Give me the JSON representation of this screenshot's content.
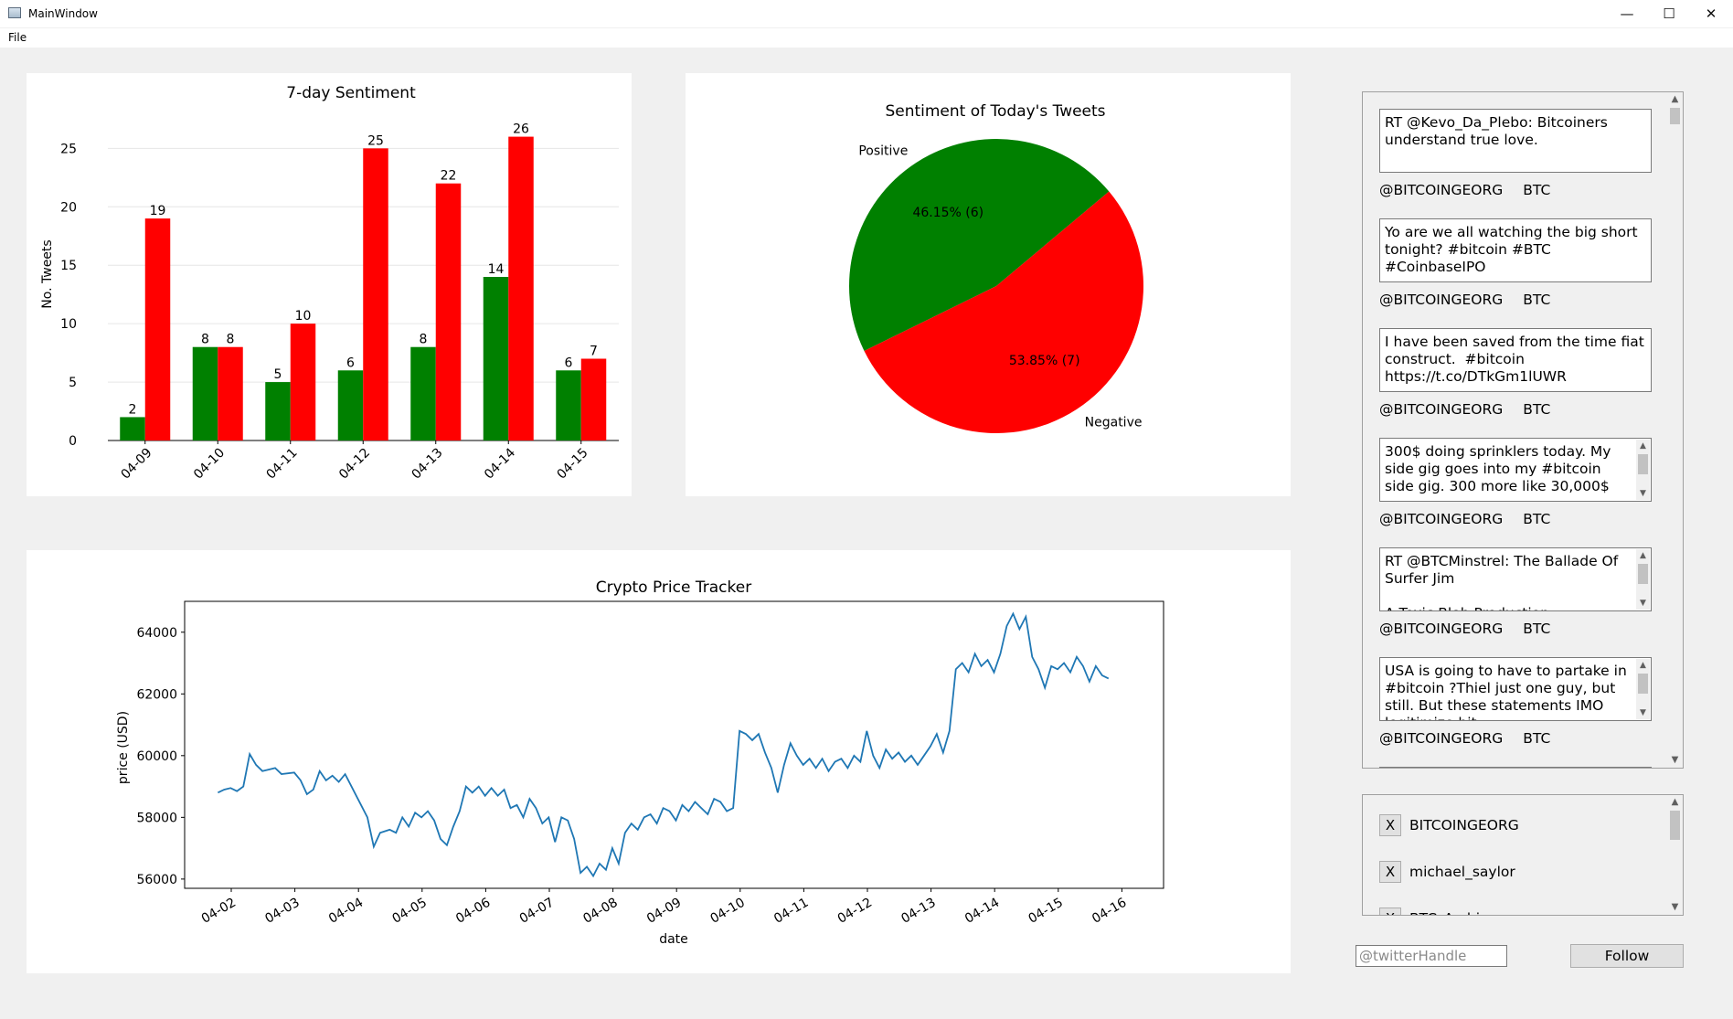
{
  "window": {
    "title": "MainWindow",
    "controls": {
      "minimize": "—",
      "maximize": "☐",
      "close": "✕"
    }
  },
  "menu": {
    "file": "File"
  },
  "sentiment7": {
    "chart_data": {
      "type": "bar",
      "title": "7-day Sentiment",
      "ylabel": "No. Tweets",
      "categories": [
        "04-09",
        "04-10",
        "04-11",
        "04-12",
        "04-13",
        "04-14",
        "04-15"
      ],
      "series": [
        {
          "values": [
            2,
            8,
            5,
            6,
            8,
            14,
            6
          ],
          "color": "#008000"
        },
        {
          "values": [
            19,
            8,
            10,
            25,
            22,
            26,
            7
          ],
          "color": "#ff0000"
        }
      ],
      "yticks": [
        0,
        5,
        10,
        15,
        20,
        25
      ],
      "ylim": [
        0,
        28
      ],
      "grid": true
    }
  },
  "today": {
    "chart_data": {
      "type": "pie",
      "title": "Sentiment of Today's Tweets",
      "slices": [
        {
          "label": "Positive",
          "value": 6,
          "pct_label": "46.15%  (6)",
          "color": "#008000"
        },
        {
          "label": "Negative",
          "value": 7,
          "pct_label": "53.85%  (7)",
          "color": "#ff0000"
        }
      ]
    }
  },
  "price": {
    "chart_data": {
      "type": "line",
      "title": "Crypto Price Tracker",
      "xlabel": "date",
      "ylabel": "price (USD)",
      "color": "#1f77b4",
      "yticks": [
        56000,
        58000,
        60000,
        62000,
        64000
      ],
      "ylim": [
        55700,
        65000
      ],
      "xticks": [
        "04-02",
        "04-03",
        "04-04",
        "04-05",
        "04-06",
        "04-07",
        "04-08",
        "04-09",
        "04-10",
        "04-11",
        "04-12",
        "04-13",
        "04-14",
        "04-15",
        "04-16"
      ],
      "x_start": "04-01 19:00",
      "x_end": "04-15 19:00",
      "points": [
        [
          0.0,
          58800
        ],
        [
          0.1,
          58900
        ],
        [
          0.2,
          58950
        ],
        [
          0.3,
          58850
        ],
        [
          0.4,
          59000
        ],
        [
          0.5,
          60050
        ],
        [
          0.6,
          59700
        ],
        [
          0.7,
          59500
        ],
        [
          0.9,
          59600
        ],
        [
          1.0,
          59400
        ],
        [
          1.2,
          59450
        ],
        [
          1.3,
          59200
        ],
        [
          1.4,
          58750
        ],
        [
          1.5,
          58900
        ],
        [
          1.6,
          59500
        ],
        [
          1.7,
          59200
        ],
        [
          1.8,
          59350
        ],
        [
          1.9,
          59150
        ],
        [
          2.0,
          59400
        ],
        [
          2.1,
          59000
        ],
        [
          2.2,
          58600
        ],
        [
          2.35,
          58000
        ],
        [
          2.45,
          57050
        ],
        [
          2.55,
          57500
        ],
        [
          2.7,
          57600
        ],
        [
          2.8,
          57500
        ],
        [
          2.9,
          58000
        ],
        [
          3.0,
          57700
        ],
        [
          3.1,
          58150
        ],
        [
          3.2,
          58000
        ],
        [
          3.3,
          58200
        ],
        [
          3.4,
          57900
        ],
        [
          3.5,
          57300
        ],
        [
          3.6,
          57100
        ],
        [
          3.7,
          57700
        ],
        [
          3.8,
          58200
        ],
        [
          3.9,
          59000
        ],
        [
          4.0,
          58800
        ],
        [
          4.1,
          59000
        ],
        [
          4.2,
          58700
        ],
        [
          4.3,
          58950
        ],
        [
          4.4,
          58700
        ],
        [
          4.5,
          58900
        ],
        [
          4.6,
          58300
        ],
        [
          4.7,
          58400
        ],
        [
          4.8,
          58000
        ],
        [
          4.9,
          58600
        ],
        [
          5.0,
          58300
        ],
        [
          5.1,
          57800
        ],
        [
          5.2,
          58000
        ],
        [
          5.3,
          57200
        ],
        [
          5.4,
          58000
        ],
        [
          5.5,
          57900
        ],
        [
          5.6,
          57300
        ],
        [
          5.7,
          56200
        ],
        [
          5.8,
          56400
        ],
        [
          5.9,
          56100
        ],
        [
          6.0,
          56500
        ],
        [
          6.1,
          56300
        ],
        [
          6.2,
          57000
        ],
        [
          6.3,
          56500
        ],
        [
          6.4,
          57500
        ],
        [
          6.5,
          57800
        ],
        [
          6.6,
          57600
        ],
        [
          6.7,
          58000
        ],
        [
          6.8,
          58100
        ],
        [
          6.9,
          57800
        ],
        [
          7.0,
          58300
        ],
        [
          7.1,
          58200
        ],
        [
          7.2,
          57900
        ],
        [
          7.3,
          58400
        ],
        [
          7.4,
          58200
        ],
        [
          7.5,
          58500
        ],
        [
          7.6,
          58300
        ],
        [
          7.7,
          58100
        ],
        [
          7.8,
          58600
        ],
        [
          7.9,
          58500
        ],
        [
          8.0,
          58200
        ],
        [
          8.1,
          58300
        ],
        [
          8.2,
          60800
        ],
        [
          8.3,
          60700
        ],
        [
          8.4,
          60500
        ],
        [
          8.5,
          60700
        ],
        [
          8.6,
          60100
        ],
        [
          8.7,
          59600
        ],
        [
          8.8,
          58800
        ],
        [
          8.9,
          59700
        ],
        [
          9.0,
          60400
        ],
        [
          9.1,
          60000
        ],
        [
          9.2,
          59700
        ],
        [
          9.3,
          59900
        ],
        [
          9.4,
          59600
        ],
        [
          9.5,
          59900
        ],
        [
          9.6,
          59500
        ],
        [
          9.7,
          59800
        ],
        [
          9.8,
          59900
        ],
        [
          9.9,
          59600
        ],
        [
          10.0,
          60000
        ],
        [
          10.1,
          59800
        ],
        [
          10.2,
          60800
        ],
        [
          10.3,
          60000
        ],
        [
          10.4,
          59600
        ],
        [
          10.5,
          60200
        ],
        [
          10.6,
          59900
        ],
        [
          10.7,
          60100
        ],
        [
          10.8,
          59800
        ],
        [
          10.9,
          60000
        ],
        [
          11.0,
          59700
        ],
        [
          11.1,
          60000
        ],
        [
          11.2,
          60300
        ],
        [
          11.3,
          60700
        ],
        [
          11.4,
          60100
        ],
        [
          11.5,
          60800
        ],
        [
          11.6,
          62800
        ],
        [
          11.7,
          63000
        ],
        [
          11.8,
          62700
        ],
        [
          11.9,
          63300
        ],
        [
          12.0,
          62900
        ],
        [
          12.1,
          63100
        ],
        [
          12.2,
          62700
        ],
        [
          12.3,
          63300
        ],
        [
          12.4,
          64200
        ],
        [
          12.5,
          64600
        ],
        [
          12.6,
          64100
        ],
        [
          12.7,
          64500
        ],
        [
          12.8,
          63200
        ],
        [
          12.9,
          62800
        ],
        [
          13.0,
          62200
        ],
        [
          13.1,
          62900
        ],
        [
          13.2,
          62800
        ],
        [
          13.3,
          63000
        ],
        [
          13.4,
          62700
        ],
        [
          13.5,
          63200
        ],
        [
          13.6,
          62900
        ],
        [
          13.7,
          62400
        ],
        [
          13.8,
          62900
        ],
        [
          13.9,
          62600
        ],
        [
          14.0,
          62500
        ]
      ]
    }
  },
  "tweets": [
    {
      "text": "RT @Kevo_Da_Plebo: Bitcoiners understand true love.",
      "user": "@BITCOINGEORG",
      "coin": "BTC",
      "scroll": false
    },
    {
      "text": "Yo are we all watching the big short tonight? #bitcoin #BTC #CoinbaseIPO",
      "user": "@BITCOINGEORG",
      "coin": "BTC",
      "scroll": false
    },
    {
      "text": "I have been saved from the time fiat construct.  #bitcoin https://t.co/DTkGm1lUWR",
      "user": "@BITCOINGEORG",
      "coin": "BTC",
      "scroll": false
    },
    {
      "text": "300$ doing sprinklers today. My side gig goes into my #bitcoin side gig. 300 more like 30,000$",
      "user": "@BITCOINGEORG",
      "coin": "BTC",
      "scroll": true
    },
    {
      "text": "RT @BTCMinstrel: The Ballade Of Surfer Jim\n\nA Toxic Blob Production",
      "user": "@BITCOINGEORG",
      "coin": "BTC",
      "scroll": true
    },
    {
      "text": "USA is going to have to partake in #bitcoin ?Thiel just one guy, but still. But these statements IMO legitimize bit https://t.co/UrDuNECKhl",
      "user": "@BITCOINGEORG",
      "coin": "BTC",
      "scroll": true
    }
  ],
  "following": [
    {
      "remove": "X",
      "name": "BITCOINGEORG"
    },
    {
      "remove": "X",
      "name": "michael_saylor"
    },
    {
      "remove": "X",
      "name": "BTC_Archive"
    }
  ],
  "follow_form": {
    "placeholder": "@twitterHandle",
    "button": "Follow"
  },
  "scroll_arrows": {
    "up": "▲",
    "down": "▼"
  }
}
